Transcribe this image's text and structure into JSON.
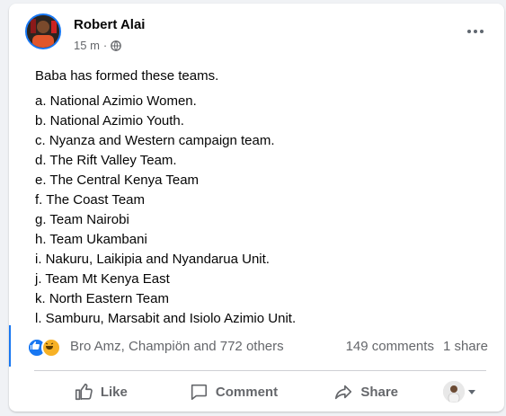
{
  "post": {
    "author": "Robert Alai",
    "time": "15 m",
    "separator": "·",
    "privacy_icon": "globe-icon",
    "intro": "Baba has formed these teams.",
    "items": [
      "a. National Azimio Women.",
      "b. National Azimio Youth.",
      "c. Nyanza and Western campaign team.",
      "d. The Rift Valley Team.",
      "e. The Central Kenya Team",
      "f. The Coast Team",
      "g. Team Nairobi",
      "h. Team Ukambani",
      "i. Nakuru, Laikipia and Nyandarua Unit.",
      "j. Team Mt Kenya East",
      "k. North Eastern Team",
      "l. Samburu, Marsabit and Isiolo Azimio Unit."
    ]
  },
  "engagement": {
    "reaction_icons": [
      "like-reaction-icon",
      "haha-reaction-icon"
    ],
    "reactors": "Bro Amz, Champiön and 772 others",
    "comments": "149 comments",
    "shares": "1 share"
  },
  "actions": {
    "like": "Like",
    "comment": "Comment",
    "share": "Share"
  },
  "colors": {
    "accent": "#1877f2",
    "secondary_text": "#65676b",
    "background": "#f0f2f5"
  }
}
